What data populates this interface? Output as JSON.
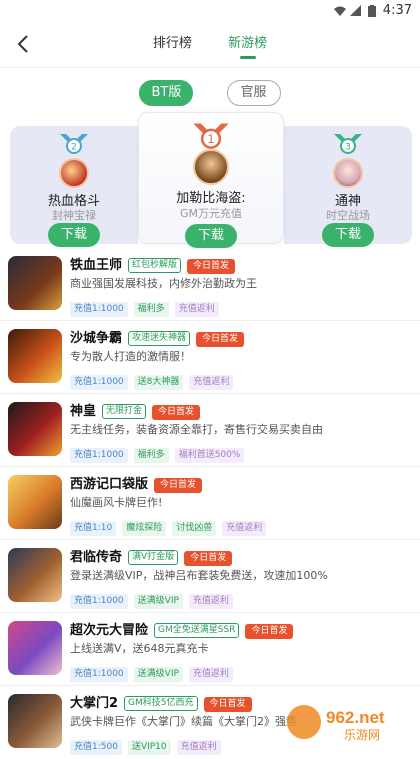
{
  "status": {
    "time": "4:37"
  },
  "header": {
    "tabs": [
      {
        "label": "排行榜"
      },
      {
        "label": "新游榜"
      }
    ],
    "active_tab": 1
  },
  "filter": {
    "options": [
      "BT版",
      "官服"
    ],
    "selected": "BT版"
  },
  "podium": [
    {
      "rank": "2",
      "name": "热血格斗",
      "sub": "封神宝禄",
      "button": "下载",
      "medal_color": "#4aa6c9"
    },
    {
      "rank": "1",
      "name": "加勒比海盗:",
      "sub": "GM万元充值",
      "button": "下载",
      "medal_color": "#e06a45"
    },
    {
      "rank": "3",
      "name": "通神",
      "sub": "时空战场",
      "button": "下载",
      "medal_color": "#3bb28a"
    }
  ],
  "games": [
    {
      "name": "铁血王师",
      "tag": "红包秒解版",
      "badge": "今日首发",
      "desc": "商业强国发展科技，内修外治勤政为王",
      "chips": [
        "充值1:1000",
        "福利多",
        "充值返利"
      ]
    },
    {
      "name": "沙城争霸",
      "tag": "攻速迷失神器",
      "badge": "今日首发",
      "desc": "专为散人打造的激情服！",
      "chips": [
        "充值1:1000",
        "送8大神器",
        "充值返利"
      ]
    },
    {
      "name": "神皇",
      "tag": "无限打金",
      "badge": "今日首发",
      "desc": "无主线任务，装备资源全靠打，寄售行交易买卖自由",
      "chips": [
        "充值1:1000",
        "福利多",
        "福利首送500%"
      ]
    },
    {
      "name": "西游记口袋版",
      "tag": "",
      "badge": "今日首发",
      "desc": "仙魔画风卡牌巨作!",
      "chips": [
        "充值1:10",
        "魔炫探险",
        "讨伐凶兽",
        "充值返利"
      ]
    },
    {
      "name": "君临传奇",
      "tag": "满V打金版",
      "badge": "今日首发",
      "desc": "登录送满级VIP，战神吕布套装免费送，攻速加100%",
      "chips": [
        "充值1:1000",
        "送满级VIP",
        "充值返利"
      ]
    },
    {
      "name": "超次元大冒险",
      "tag": "GM全免送满星SSR",
      "badge": "今日首发",
      "desc": "上线送满V，送648元真充卡",
      "chips": [
        "充值1:1000",
        "送满级VIP",
        "充值返利"
      ]
    },
    {
      "name": "大掌门2",
      "tag": "GM科技5亿西充",
      "badge": "今日首发",
      "desc": "武侠卡牌巨作《大掌门》续篇《大掌门2》强势",
      "chips": [
        "充值1:500",
        "送VIP10",
        "充值返利"
      ]
    }
  ],
  "watermark": {
    "text": "962.net",
    "sub": "乐游网"
  }
}
